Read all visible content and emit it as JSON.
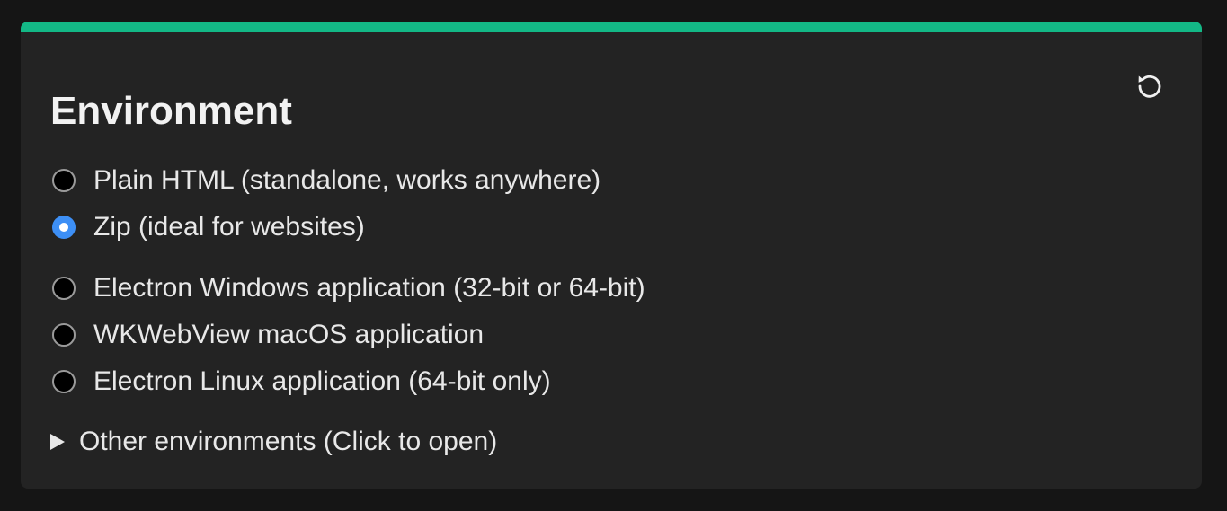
{
  "panel": {
    "title": "Environment",
    "accent_color": "#13b886",
    "reset_icon": "reset-icon",
    "options": [
      {
        "label": "Plain HTML (standalone, works anywhere)",
        "checked": false
      },
      {
        "label": "Zip (ideal for websites)",
        "checked": true
      },
      {
        "label": "Electron Windows application (32-bit or 64-bit)",
        "checked": false
      },
      {
        "label": "WKWebView macOS application",
        "checked": false
      },
      {
        "label": "Electron Linux application (64-bit only)",
        "checked": false
      }
    ],
    "more": {
      "label": "Other environments (Click to open)",
      "icon": "disclosure-triangle-icon"
    }
  }
}
